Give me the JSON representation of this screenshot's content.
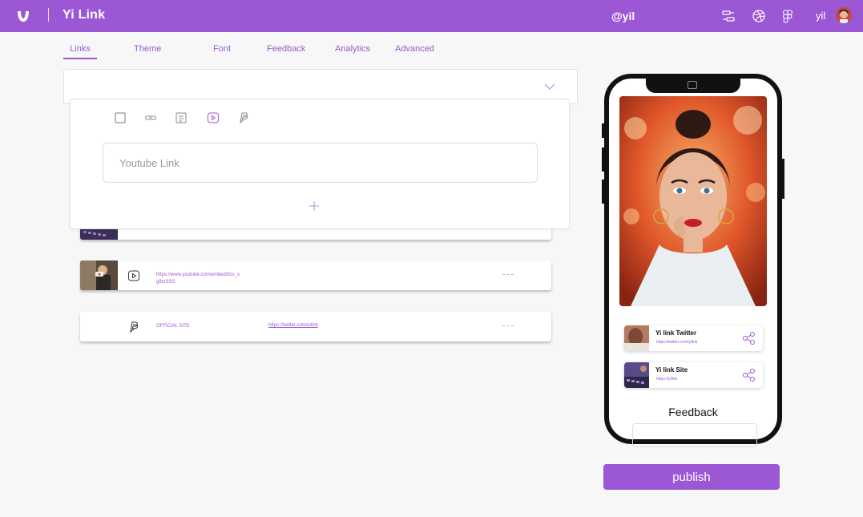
{
  "app": {
    "brand": "Yi Link",
    "handle": "@yil",
    "user_name": "yil"
  },
  "tabs": [
    {
      "label": "Links",
      "active": true
    },
    {
      "label": "Theme"
    },
    {
      "label": "Font"
    },
    {
      "label": "Feedback"
    },
    {
      "label": "Analytics"
    },
    {
      "label": "Advanced"
    }
  ],
  "panel": {
    "input_placeholder": "Youtube Link",
    "type_icons": [
      "square-icon",
      "link-icon",
      "text-icon",
      "youtube-icon",
      "paypal-icon"
    ]
  },
  "rows": [
    {
      "icon": "youtube-icon",
      "text": "https://www.youtube.com/embed/9zs_x\ng9xrSSS",
      "url": ""
    },
    {
      "icon": "paypal-icon",
      "text": "OFFICIAL SITE",
      "url": "https://twitter.com/yilink"
    }
  ],
  "phone": {
    "cards": [
      {
        "title": "Yi link Twitter",
        "sub": "https://twitter.com/yilink"
      },
      {
        "title": "Yi link Site",
        "sub": "https://yilink"
      }
    ],
    "feedback_title": "Feedback"
  },
  "publish_label": "publish",
  "colors": {
    "accent": "#9b57d4",
    "background": "#f7f7f7"
  }
}
